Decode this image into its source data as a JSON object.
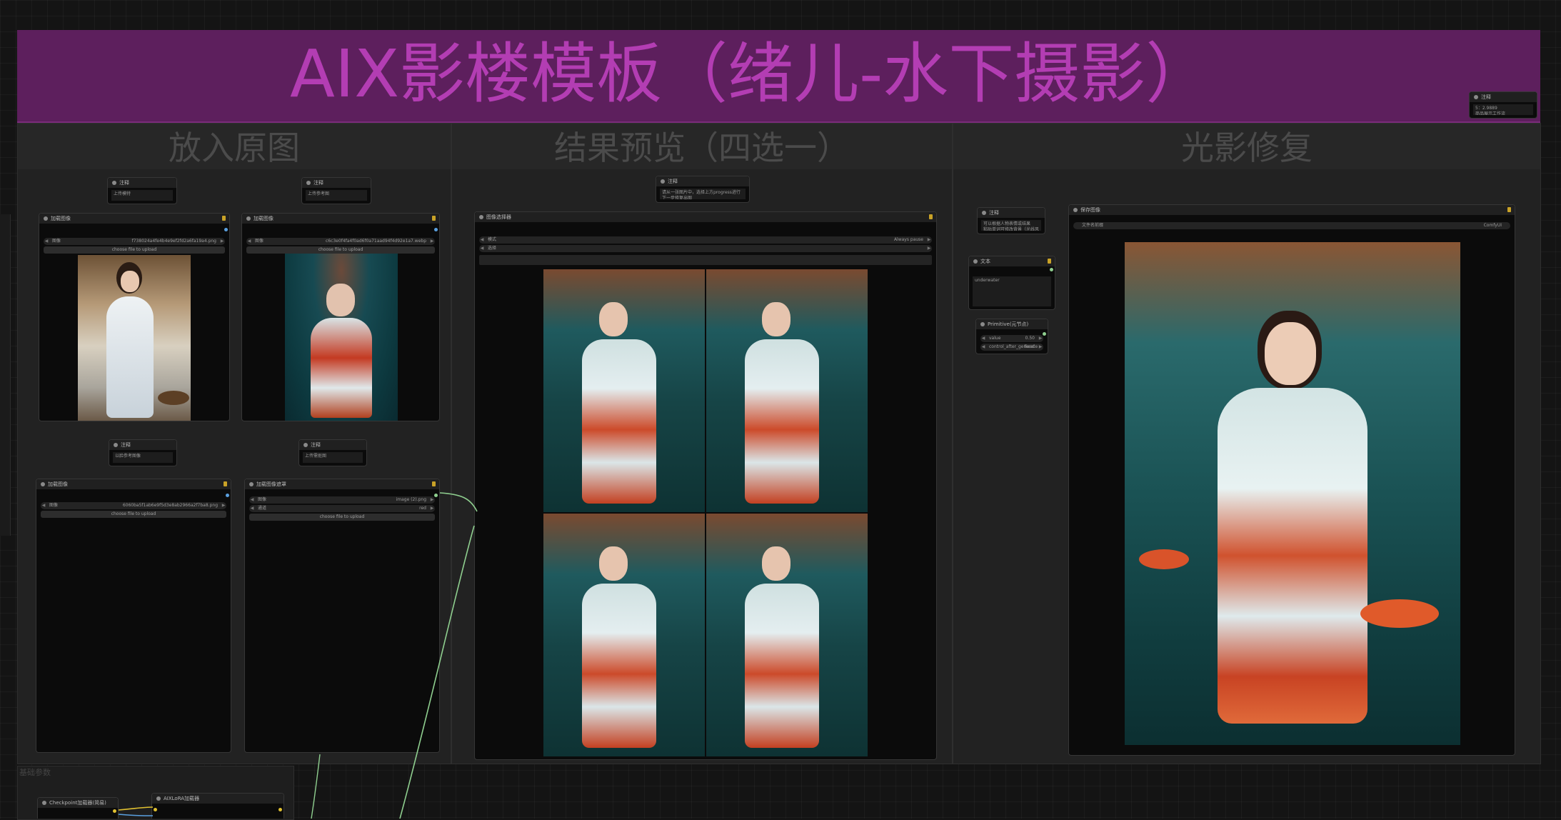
{
  "banner": {
    "title": "AIX影楼模板（绪儿-水下摄影）"
  },
  "groups": {
    "input": "放入原图",
    "preview": "结果预览（四选一）",
    "relight": "光影修复",
    "basic": "基础参数"
  },
  "notes": {
    "top_right": {
      "title": "注释",
      "body": "5：2.9889\n商品展示工作流"
    },
    "input_a": {
      "title": "注释",
      "body": "上传模特"
    },
    "input_b": {
      "title": "注释",
      "body": "上传参考图"
    },
    "input_c": {
      "title": "注释",
      "body": "以脸参考图像"
    },
    "input_d": {
      "title": "注释",
      "body": "上传需抠图"
    },
    "preview": {
      "title": "注释",
      "body": "请从一张图片中，选择上方progress进行下一步修复出图"
    },
    "relight": {
      "title": "注释",
      "body": "可以根据人物表情或结果\n粘贴单词可修改背景（光线风格）"
    }
  },
  "nodes": {
    "load_image_1": {
      "title": "加载图像",
      "label": "图像",
      "value": "f738024a4fe4b4e9ef2fd2a6fa19a4.png",
      "upload": "choose file to upload"
    },
    "load_image_2": {
      "title": "加载图像",
      "label": "图像",
      "value": "c6c3e0f4fa4f0ad6f0a71aad94f4d92e1a7.webp",
      "upload": "choose file to upload"
    },
    "load_image_3": {
      "title": "加载图像",
      "label": "图像",
      "value": "6060ba5f1ab6e9f5d3e8ab2966a2f7ba8.png",
      "upload": "choose file to upload"
    },
    "load_image_mask": {
      "title": "加载图像遮罩",
      "label_1": "图像",
      "value_1": "image (2).png",
      "label_2": "通道",
      "value_2": "red",
      "upload": "choose file to upload"
    },
    "image_selector": {
      "title": "图像选择器",
      "label_1": "模式",
      "value_1": "Always pause",
      "label_2": "选择"
    },
    "save_image": {
      "title": "保存图像",
      "label": "文件名前缀",
      "value": "ComfyUI"
    },
    "text": {
      "title": "文本",
      "body": "underwater"
    },
    "primitive": {
      "title": "Primitive(元节点)",
      "label_1": "value",
      "value_1": "0.50",
      "label_2": "control_after_generate",
      "value_2": "fixed"
    },
    "checkpoint": {
      "title": "Checkpoint加载器(简易)"
    },
    "lora": {
      "title": "AIXLoRA加载器"
    }
  },
  "colors": {
    "banner": "#5d1f5d",
    "banner_text": "#b33db3",
    "wire": "#8fcf8f",
    "link_yellow": "#e0c030",
    "link_blue": "#5aa0e0"
  }
}
